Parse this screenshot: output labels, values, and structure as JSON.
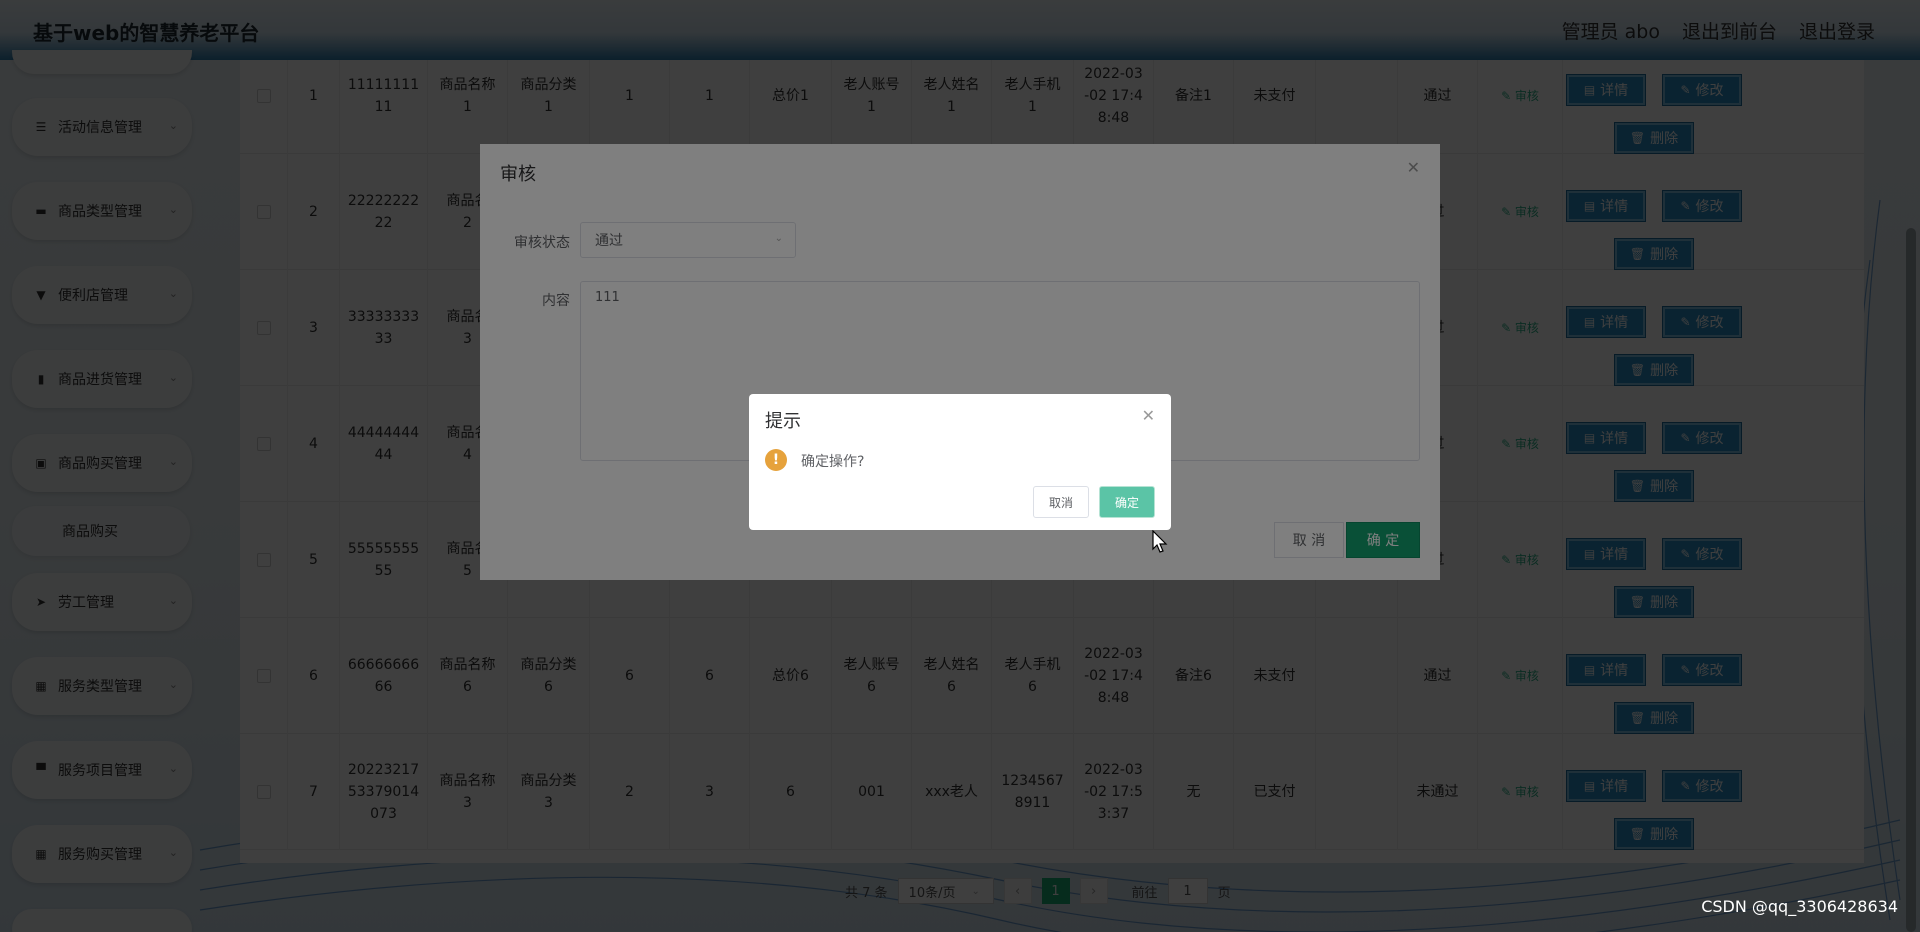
{
  "header": {
    "title": "基于web的智慧养老平台",
    "user_label": "管理员 abo",
    "to_front": "退出到前台",
    "logout": "退出登录"
  },
  "sidebar": {
    "items": [
      {
        "icon": "sliders-icon",
        "glyph": "☰",
        "label": "活动信息管理"
      },
      {
        "icon": "ticket-icon",
        "glyph": "▬",
        "label": "商品类型管理"
      },
      {
        "icon": "shop-icon",
        "glyph": "▼",
        "label": "便利店管理"
      },
      {
        "icon": "grid-icon",
        "glyph": "▮",
        "label": "商品进货管理"
      },
      {
        "icon": "cart-icon",
        "glyph": "▣",
        "label": "商品购买管理"
      },
      {
        "icon": "send-icon",
        "glyph": "➤",
        "label": "劳工管理"
      },
      {
        "icon": "apps-icon",
        "glyph": "▦",
        "label": "服务类型管理"
      },
      {
        "icon": "monitor-icon",
        "glyph": "▀",
        "label": "服务项目管理"
      },
      {
        "icon": "apps-icon",
        "glyph": "▦",
        "label": "服务购买管理"
      }
    ],
    "sub_item": "商品购买"
  },
  "table": {
    "audit_label": "审核",
    "buttons": {
      "detail": "详情",
      "edit": "修改",
      "delete": "删除"
    },
    "rows": [
      {
        "idx": "1",
        "order_no": "11111111\n11",
        "name": "商品名称\n1",
        "category": "商品分类\n1",
        "c1": "1",
        "c2": "1",
        "total": "总价1",
        "acct": "老人账号\n1",
        "elder": "老人姓名\n1",
        "phone": "老人手机\n1",
        "time": "2022-03\n-02 17:4\n8:48",
        "remark": "备注1",
        "pay": "未支付",
        "status": "通过"
      },
      {
        "idx": "2",
        "order_no": "22222222\n22",
        "name": "商品名\n2",
        "category": "",
        "c1": "",
        "c2": "",
        "total": "",
        "acct": "",
        "elder": "",
        "phone": "",
        "time": "",
        "remark": "",
        "pay": "",
        "status": "过"
      },
      {
        "idx": "3",
        "order_no": "33333333\n33",
        "name": "商品名\n3",
        "category": "",
        "c1": "",
        "c2": "",
        "total": "",
        "acct": "",
        "elder": "",
        "phone": "",
        "time": "",
        "remark": "",
        "pay": "",
        "status": "过"
      },
      {
        "idx": "4",
        "order_no": "44444444\n44",
        "name": "商品名\n4",
        "category": "",
        "c1": "",
        "c2": "",
        "total": "",
        "acct": "",
        "elder": "",
        "phone": "",
        "time": "",
        "remark": "",
        "pay": "",
        "status": "过"
      },
      {
        "idx": "5",
        "order_no": "55555555\n55",
        "name": "商品名\n5",
        "category": "5",
        "c1": "",
        "c2": "",
        "total": "",
        "acct": "5",
        "elder": "5",
        "phone": "5",
        "time": "8:48",
        "remark": "",
        "pay": "",
        "status": "过"
      },
      {
        "idx": "6",
        "order_no": "66666666\n66",
        "name": "商品名称\n6",
        "category": "商品分类\n6",
        "c1": "6",
        "c2": "6",
        "total": "总价6",
        "acct": "老人账号\n6",
        "elder": "老人姓名\n6",
        "phone": "老人手机\n6",
        "time": "2022-03\n-02 17:4\n8:48",
        "remark": "备注6",
        "pay": "未支付",
        "status": "通过"
      },
      {
        "idx": "7",
        "order_no": "20223217\n53379014\n073",
        "name": "商品名称\n3",
        "category": "商品分类\n3",
        "c1": "2",
        "c2": "3",
        "total": "6",
        "acct": "001",
        "elder": "xxx老人",
        "phone": "1234567\n8911",
        "time": "2022-03\n-02 17:5\n3:37",
        "remark": "无",
        "pay": "已支付",
        "status": "未通过"
      }
    ]
  },
  "pager": {
    "total": "共 7 条",
    "page_size": "10条/页",
    "current": "1",
    "goto_label": "前往",
    "goto_value": "1",
    "page_suffix": "页"
  },
  "audit_dialog": {
    "title": "审核",
    "status_label": "审核状态",
    "status_value": "通过",
    "content_label": "内容",
    "content_value": "111",
    "cancel": "取 消",
    "confirm": "确 定"
  },
  "confirm_box": {
    "title": "提示",
    "message": "确定操作?",
    "cancel": "取消",
    "confirm": "确定"
  },
  "watermark": "CSDN @qq_3306428634",
  "colors": {
    "primary_green": "#13a06e",
    "button_blue": "#2a8fc7",
    "warn": "#e6a23c"
  }
}
